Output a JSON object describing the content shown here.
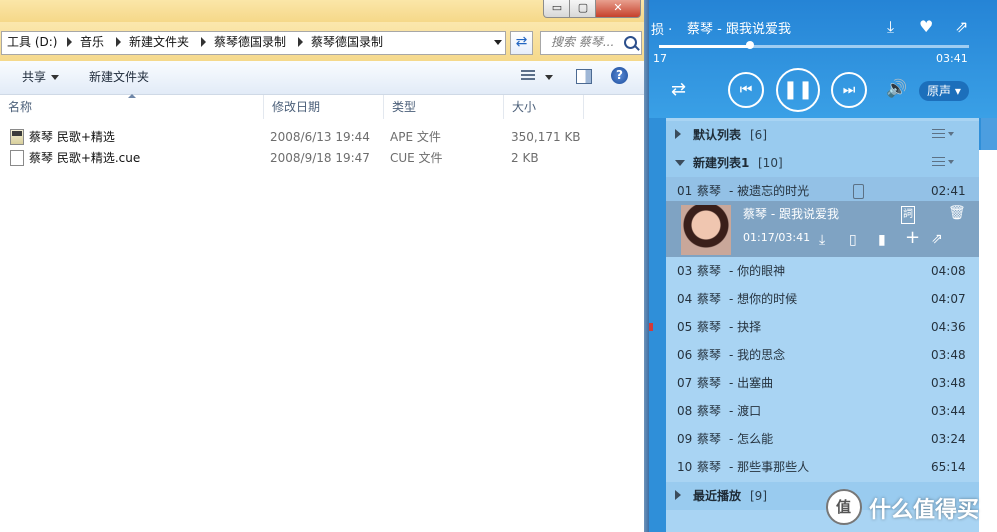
{
  "explorer": {
    "window_buttons": {
      "minimize": "▭",
      "maximize": "▢",
      "close": "✕"
    },
    "breadcrumbs": [
      "工具 (D:)",
      "音乐",
      "新建文件夹",
      "蔡琴德国录制",
      "蔡琴德国录制"
    ],
    "search_placeholder": "搜索 蔡琴...",
    "toolbar": {
      "share": "共享",
      "new_folder": "新建文件夹"
    },
    "columns": {
      "name": "名称",
      "modified": "修改日期",
      "type": "类型",
      "size": "大小"
    },
    "files": [
      {
        "name": "蔡琴 民歌+精选",
        "modified": "2008/6/13 19:44",
        "type": "APE 文件",
        "size": "350,171 KB"
      },
      {
        "name": "蔡琴 民歌+精选.cue",
        "modified": "2008/9/18 19:47",
        "type": "CUE 文件",
        "size": "2 KB"
      }
    ]
  },
  "player": {
    "quality_tag": "损 ·",
    "now_playing": "蔡琴 - 跟我说爱我",
    "time_current": "17",
    "time_total": "03:41",
    "progress_fraction": 0.3,
    "sound_mode": "原声 ▾",
    "lists": {
      "default": {
        "title": "默认列表",
        "count": "[6]"
      },
      "new": {
        "title": "新建列表1",
        "count": "[10]"
      },
      "recent": {
        "title": "最近播放",
        "count": "[9]"
      }
    },
    "current_track": {
      "title": "蔡琴 - 跟我说爱我",
      "time": "01:17/03:41",
      "lyrics_badge": "詞"
    },
    "tracks": [
      {
        "num": "01",
        "artist": "蔡琴",
        "title": "-  被遗忘的时光",
        "duration": "02:41"
      },
      {
        "num": "03",
        "artist": "蔡琴",
        "title": "-  你的眼神",
        "duration": "04:08"
      },
      {
        "num": "04",
        "artist": "蔡琴",
        "title": "-  想你的时候",
        "duration": "04:07"
      },
      {
        "num": "05",
        "artist": "蔡琴",
        "title": "-  抉择",
        "duration": "04:36"
      },
      {
        "num": "06",
        "artist": "蔡琴",
        "title": "-  我的思念",
        "duration": "03:48"
      },
      {
        "num": "07",
        "artist": "蔡琴",
        "title": "-  出塞曲",
        "duration": "03:48"
      },
      {
        "num": "08",
        "artist": "蔡琴",
        "title": "-  渡口",
        "duration": "03:44"
      },
      {
        "num": "09",
        "artist": "蔡琴",
        "title": "-  怎么能",
        "duration": "03:24"
      },
      {
        "num": "10",
        "artist": "蔡琴",
        "title": "-  那些事那些人",
        "duration": "65:14"
      }
    ]
  },
  "watermark": {
    "text": "什么值得买"
  },
  "colors": {
    "player_blue": "#2f8fd9",
    "playlist_bg": "#a9d4f3",
    "explorer_title": "#f5d889"
  }
}
